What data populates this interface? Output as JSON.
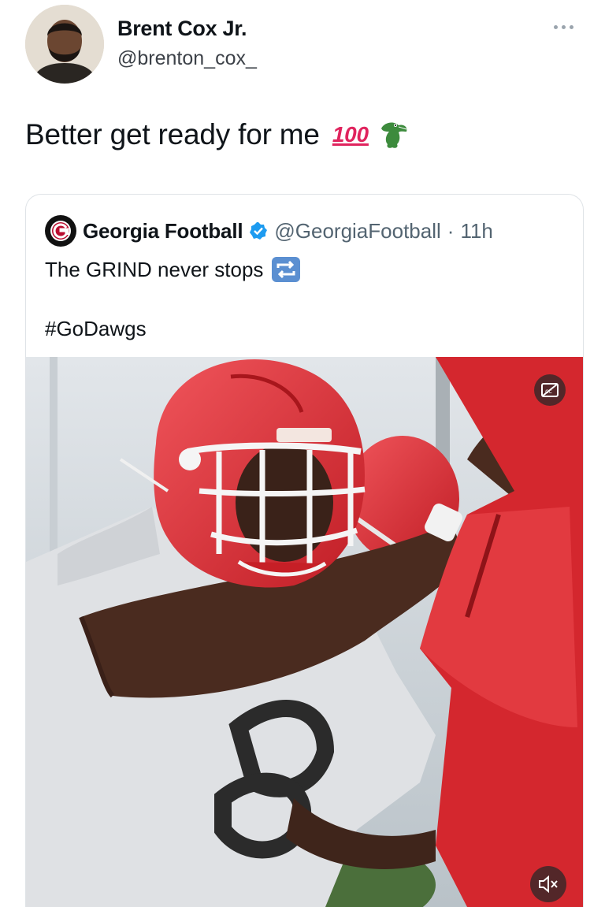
{
  "author": {
    "name": "Brent Cox Jr.",
    "handle": "@brenton_cox_",
    "avatar_icon": "profile-photo"
  },
  "tweet": {
    "text": "Better get ready for me",
    "emoji_hundred": "100",
    "emoji_gator_icon": "alligator-emoji"
  },
  "quoted": {
    "name": "Georgia Football",
    "handle": "@GeorgiaFootball",
    "separator": "·",
    "time": "11h",
    "text": "The GRIND never stops",
    "hashtag": "#GoDawgs",
    "verified_icon": "verified-badge-icon",
    "repeat_icon": "repeat-emoji",
    "accent_color": "#1d9bf0"
  },
  "media": {
    "cc_icon": "closed-captions-icon",
    "mute_icon": "muted-speaker-icon",
    "helmet_color": "#d7262c"
  }
}
